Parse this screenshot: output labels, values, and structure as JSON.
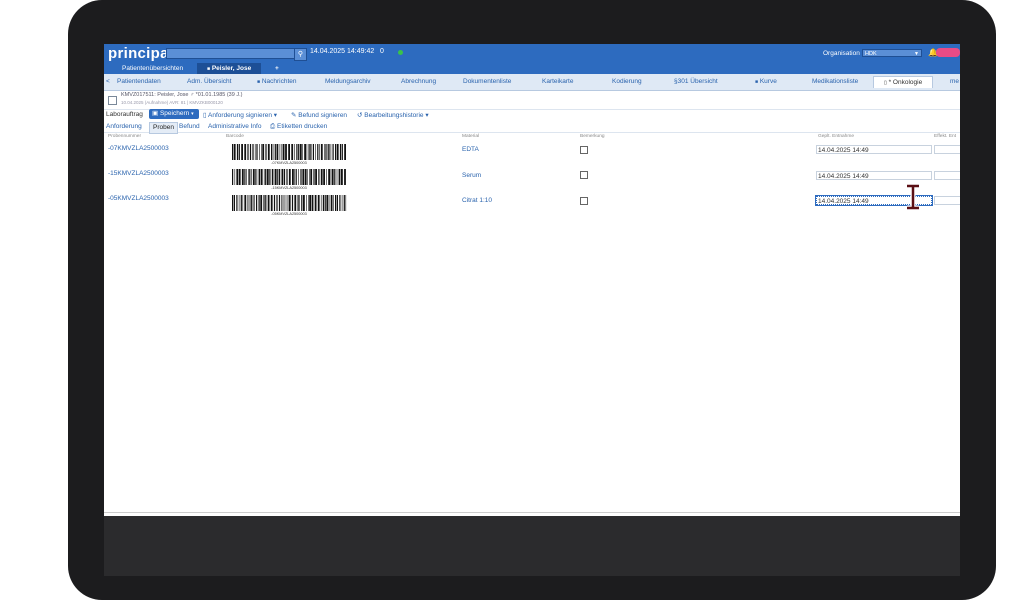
{
  "app": {
    "logo": "principa",
    "clock": "14.04.2025 14:49:42",
    "counter": "0",
    "organisation_label": "Organisation",
    "organisation_value": "HDK"
  },
  "patient_tabs": [
    {
      "label": "Patientenübersichten"
    },
    {
      "label": "Peisler, Jose"
    },
    {
      "label": "+"
    }
  ],
  "nav_tabs": [
    {
      "label": "Patientendaten"
    },
    {
      "label": "Adm. Übersicht"
    },
    {
      "label": "Nachrichten"
    },
    {
      "label": "Meldungsarchiv"
    },
    {
      "label": "Abrechnung"
    },
    {
      "label": "Dokumentenliste"
    },
    {
      "label": "Karteikarte"
    },
    {
      "label": "Kodierung"
    },
    {
      "label": "§301 Übersicht"
    },
    {
      "label": "Kurve"
    },
    {
      "label": "Medikationsliste"
    },
    {
      "label": "* Onkologie"
    },
    {
      "label": "me"
    }
  ],
  "patient": {
    "line1": "KMVZ017511: Peisler, Jose ♂ *01.01.1985 (39 J.)",
    "line2": "10.04.2025 (Aufnahme) AVR: 81 | KMVZKB000120"
  },
  "toolbar": {
    "label": "Laborauftrag",
    "save": "Speichern",
    "sign_request": "Anforderung signieren",
    "sign_result": "Befund signieren",
    "history": "Bearbeitungshistorie"
  },
  "subtabs": [
    {
      "label": "Anforderung"
    },
    {
      "label": "Proben"
    },
    {
      "label": "Befund"
    },
    {
      "label": "Administrative Info"
    },
    {
      "label": "Etiketten drucken"
    }
  ],
  "table": {
    "headers": {
      "probennummer": "Probennummer",
      "barcode": "Barcode",
      "material": "Material",
      "bemerkung": "Bemerkung",
      "entnahme": "Geplt. Entnahme",
      "effekt": "Effekt. Ent"
    },
    "rows": [
      {
        "number": "-07KMVZLA2500003",
        "barcode_text": "-07KMVZLA2500003",
        "material": "EDTA",
        "entnahme": "14.04.2025 14:49"
      },
      {
        "number": "-15KMVZLA2500003",
        "barcode_text": "-15KMVZLA2500003",
        "material": "Serum",
        "entnahme": "14.04.2025 14:49"
      },
      {
        "number": "-05KMVZLA2500003",
        "barcode_text": "-05KMVZLA2500003",
        "material": "Citrat 1:10",
        "entnahme": "14.04.2025 14:49"
      }
    ]
  }
}
